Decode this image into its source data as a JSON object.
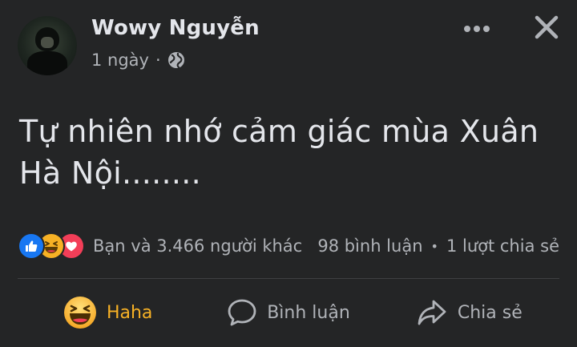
{
  "post": {
    "author": "Wowy Nguyễn",
    "time": "1 ngày",
    "separator": "·",
    "audience_icon": "globe-icon",
    "text": "Tự nhiên nhớ cảm giác mùa Xuân\nHà Nội........"
  },
  "header": {
    "more_icon": "more-dots-icon",
    "close_icon": "close-icon"
  },
  "reactions": {
    "types": [
      "like",
      "haha",
      "love"
    ],
    "summary": "Bạn và 3.466 người khác",
    "comments": "98 bình luận",
    "dot": "•",
    "shares": "1 lượt chia sẻ"
  },
  "actions": {
    "reaction_label": "Haha",
    "comment_label": "Bình luận",
    "share_label": "Chia sẻ"
  },
  "colors": {
    "background": "#242526",
    "text_primary": "#e4e6eb",
    "text_secondary": "#b0b3b8",
    "haha_active": "#f7b125",
    "like_blue": "#1877f2",
    "love_red": "#f33e58"
  }
}
